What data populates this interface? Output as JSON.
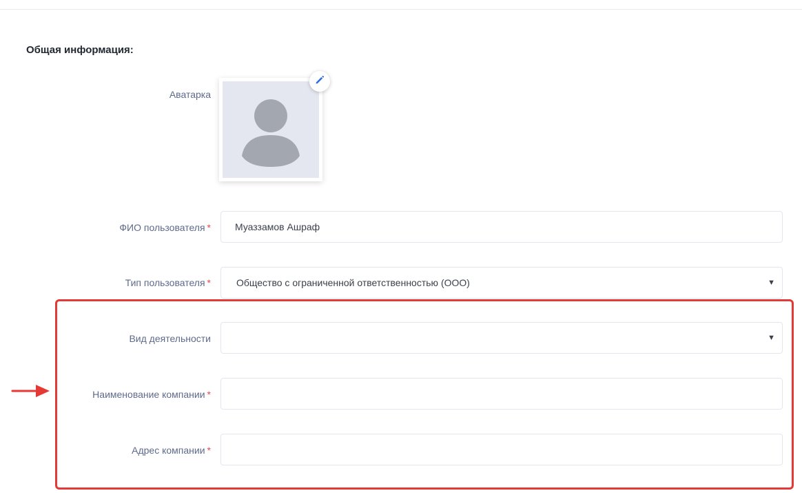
{
  "section": {
    "title": "Общая информация:"
  },
  "avatar": {
    "label": "Аватарка",
    "edit_icon": "pencil-icon",
    "placeholder_icon": "user-silhouette-icon"
  },
  "fields": {
    "full_name": {
      "label": "ФИО пользователя",
      "required": "*",
      "value": "Муаззамов Ашраф"
    },
    "user_type": {
      "label": "Тип пользователя",
      "required": "*",
      "value": "Общество с ограниченной ответственностью (ООО)"
    },
    "activity": {
      "label": "Вид деятельности",
      "value": ""
    },
    "company_name": {
      "label": "Наименование компании",
      "required": "*",
      "value": ""
    },
    "company_address": {
      "label": "Адрес компании",
      "required": "*",
      "value": ""
    }
  },
  "icons": {
    "select_caret": "caret-down-icon",
    "pointer_arrow": "arrow-right-icon"
  },
  "colors": {
    "highlight": "#e53935",
    "label": "#5d6a8b",
    "required": "#e5484d",
    "accent": "#2f6fe4"
  }
}
